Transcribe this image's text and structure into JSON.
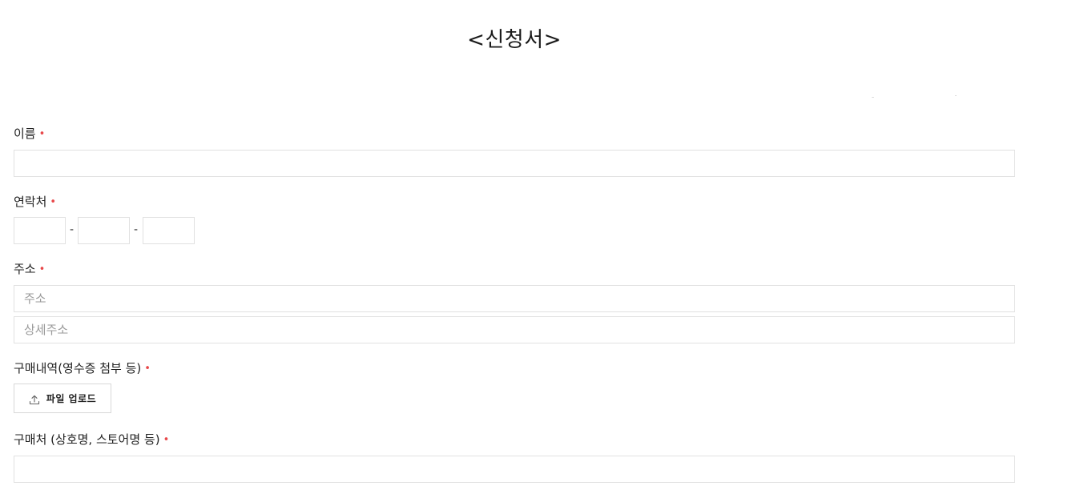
{
  "form": {
    "title": "<신청서>",
    "name": {
      "label": "이름",
      "required_mark": "•",
      "value": ""
    },
    "contact": {
      "label": "연락처",
      "required_mark": "•",
      "parts": [
        "",
        "",
        ""
      ],
      "separator": "-"
    },
    "address": {
      "label": "주소",
      "required_mark": "•",
      "address_placeholder": "주소",
      "detail_placeholder": "상세주소"
    },
    "purchase_history": {
      "label": "구매내역(영수증 첨부 등)",
      "required_mark": "•",
      "upload_label": "파일 업로드",
      "upload_icon": "upload-icon"
    },
    "purchase_place": {
      "label": "구매처 (상호명, 스토어명 등)",
      "required_mark": "•",
      "value": ""
    }
  },
  "colors": {
    "required": "#e8484a",
    "border": "#e1e1e1",
    "placeholder": "#9a9a9a"
  }
}
